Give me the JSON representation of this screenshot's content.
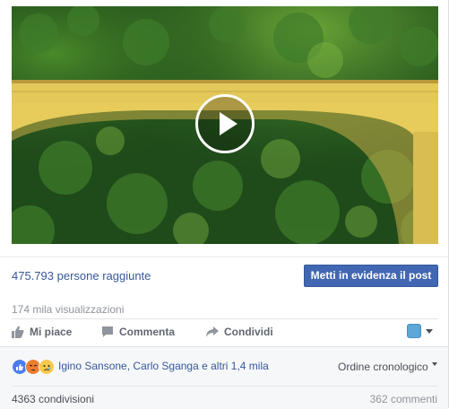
{
  "video": {
    "play_icon": "play-icon"
  },
  "stats": {
    "reach_text": "475.793 persone raggiunte",
    "boost_label": "Metti in evidenza il post",
    "views_text": "174 mila visualizzazioni"
  },
  "actions": {
    "like_label": "Mi piace",
    "comment_label": "Commenta",
    "share_label": "Condividi"
  },
  "reactions": {
    "icons": [
      "like-icon",
      "angry-icon",
      "sad-icon"
    ],
    "names_text": "Igino Sansone, Carlo Sganga e altri 1,4 mila",
    "order_label": "Ordine cronologico"
  },
  "footer": {
    "shares_text": "4363 condivisioni",
    "comments_text": "362 commenti"
  },
  "colors": {
    "link": "#365899",
    "boost_bg": "#4267b2",
    "muted": "#90949c",
    "panel_bg": "#f6f7f9"
  }
}
